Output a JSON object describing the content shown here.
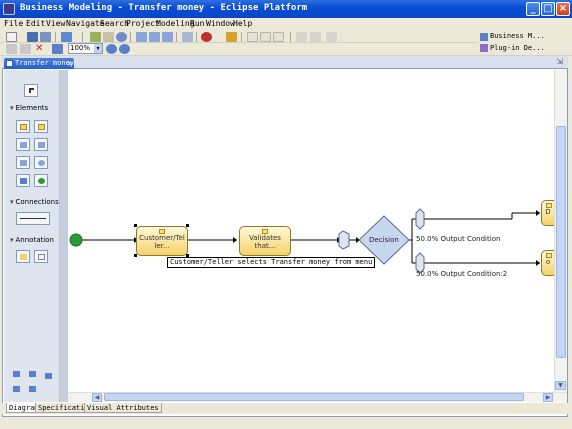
{
  "window": {
    "title": "Business Modeling - Transfer money - Eclipse Platform",
    "controls": {
      "minimize": "_",
      "maximize": "□",
      "close": "×"
    }
  },
  "menu": [
    "File",
    "Edit",
    "View",
    "Navigate",
    "Search",
    "Project",
    "Modeling",
    "Run",
    "Window",
    "Help"
  ],
  "toolbar": {
    "zoom_value": "100%",
    "zoom_dropdown": "▾"
  },
  "perspectives": {
    "current": "Business M...",
    "other": "Plug-in De..."
  },
  "editor": {
    "tab_label": "Transfer money",
    "tab_close": "✕",
    "restore": "⇲"
  },
  "palette": {
    "sections": {
      "elements": "Elements",
      "connections": "Connections",
      "annotation": "Annotation"
    }
  },
  "diagram": {
    "task1": {
      "line1": "Customer/Tel",
      "line2": "ler..."
    },
    "task2": {
      "line1": "Validates",
      "line2": "that..."
    },
    "decision": "Decision",
    "branch1": "50.0%  Output Condition",
    "branch2": "50.0%  Output Condition:2",
    "tooltip": "Customer/Teller selects Transfer money from menu",
    "partial_top": "D",
    "partial_bottom": "o"
  },
  "bottom_tabs": [
    "Diagram",
    "Specification",
    "Visual Attributes"
  ],
  "colors": {
    "title_bar": "#0a4fd6",
    "task_fill": "#f5d36a",
    "decision_fill": "#c9d6f0",
    "start_event": "#2e9a3a"
  }
}
